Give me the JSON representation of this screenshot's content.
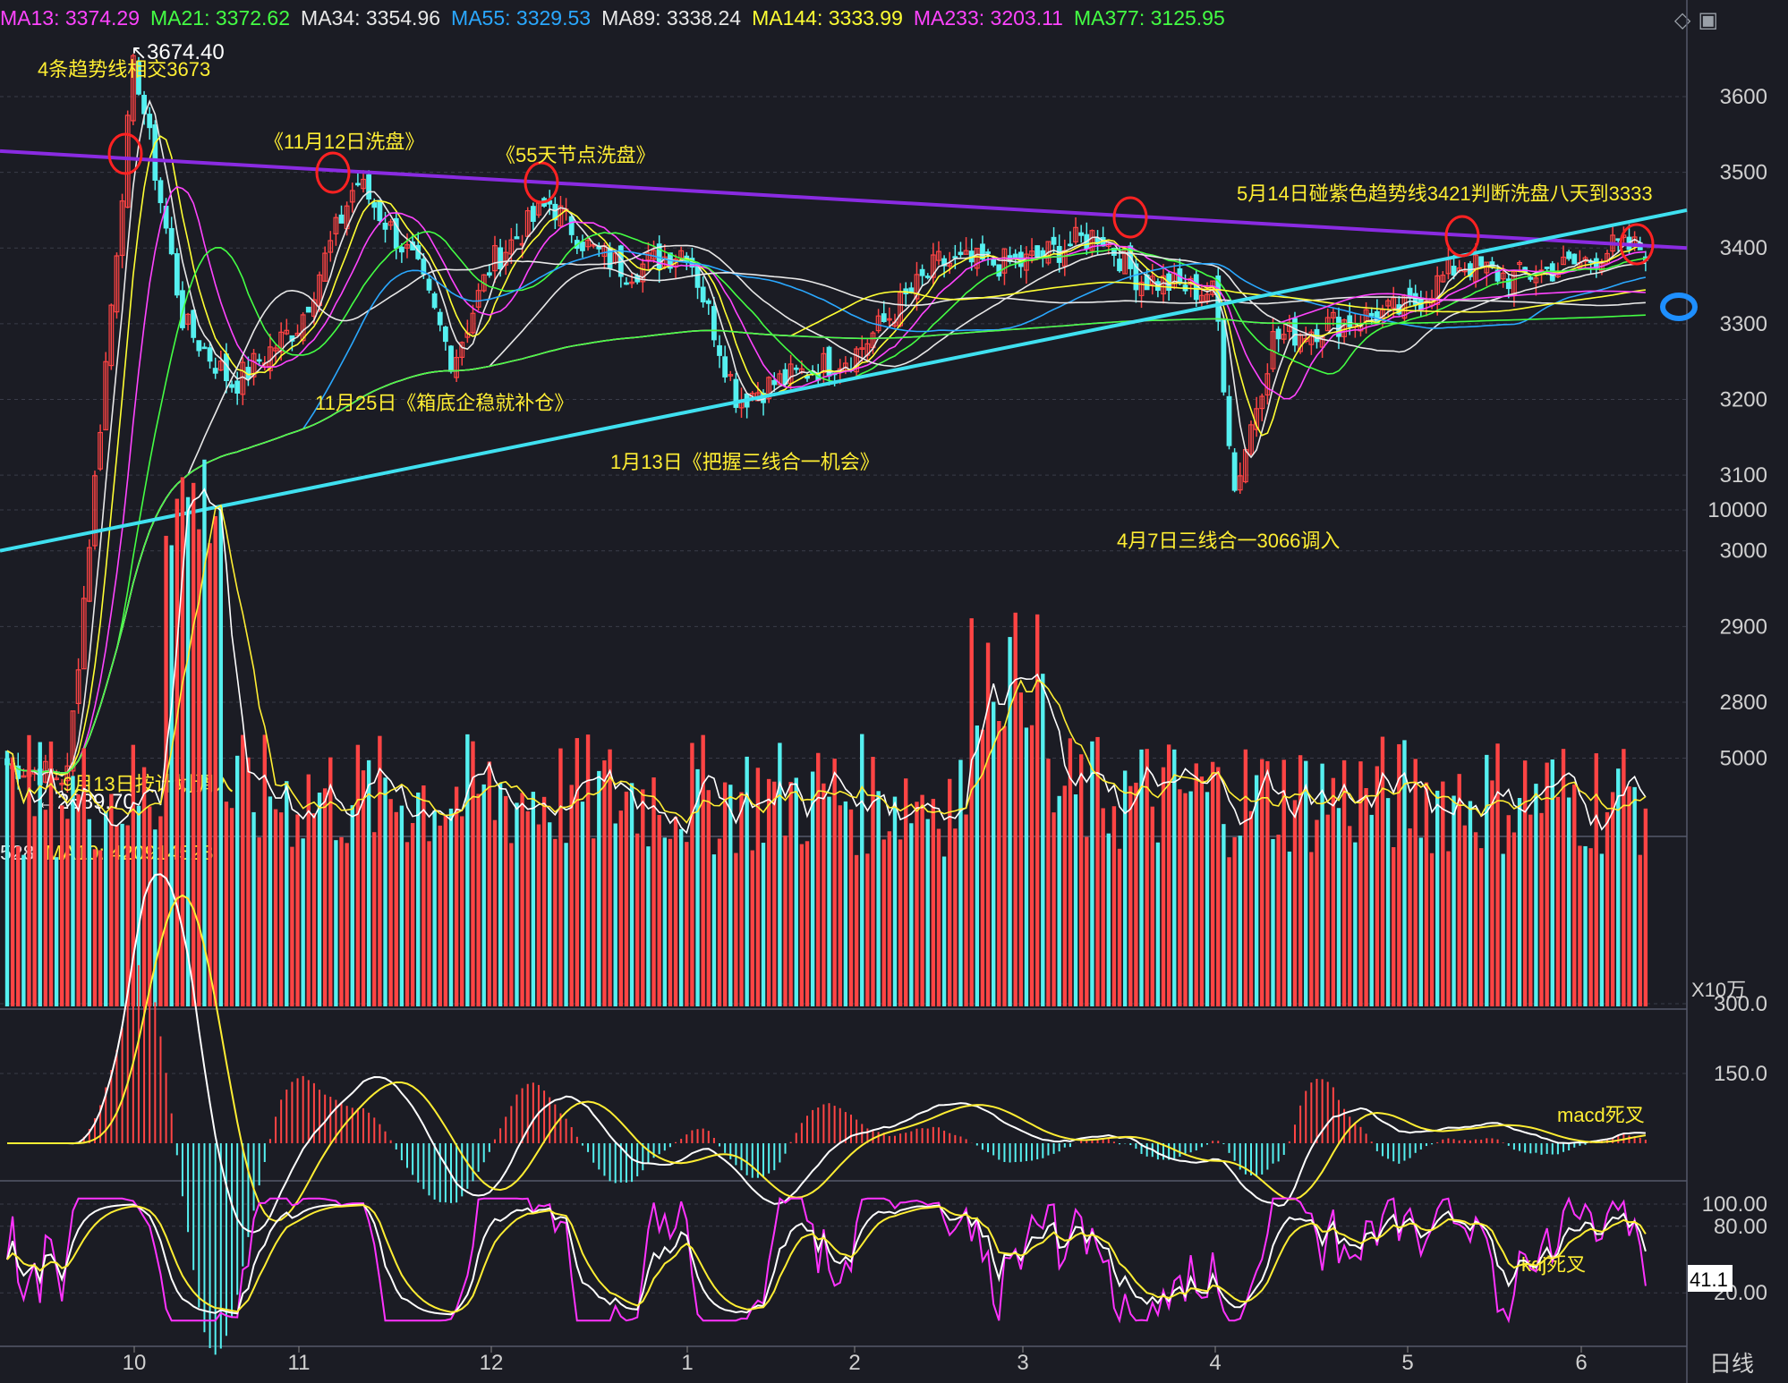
{
  "header": {
    "ma": [
      {
        "label": "MA13: 3374.29",
        "color": "#ff44ff"
      },
      {
        "label": "MA21: 3372.62",
        "color": "#44ff44"
      },
      {
        "label": "MA34: 3354.96",
        "color": "#e8e8e8"
      },
      {
        "label": "MA55: 3329.53",
        "color": "#2aa8ff"
      },
      {
        "label": "MA89: 3338.24",
        "color": "#e8e8e8"
      },
      {
        "label": "MA144: 3333.99",
        "color": "#ffff33"
      },
      {
        "label": "MA233: 3203.11",
        "color": "#ff44ff"
      },
      {
        "label": "MA377: 3125.95",
        "color": "#44ff44"
      }
    ],
    "icons": [
      "diamond-icon",
      "panel-icon"
    ]
  },
  "volume_header": {
    "v1": "528",
    "v2": "MA10: 420914528"
  },
  "colors": {
    "up": "#ff4444",
    "down": "#55f0f0",
    "trend_purple": "#8a2be2",
    "trend_cyan": "#3fe0f0",
    "annot": "#ffee33",
    "circle": "#ff2222",
    "grid": "#3a3c48",
    "axis_text": "#d0d0d0",
    "mark": "#1e8fff"
  },
  "chart_data": {
    "type": "candlestick",
    "x_months": [
      "10",
      "11",
      "12",
      "1",
      "2",
      "3",
      "4",
      "5",
      "6"
    ],
    "period_label": "日线",
    "price_axis": {
      "ticks": [
        2800,
        2900,
        3000,
        3100,
        3200,
        3300,
        3400,
        3500,
        3600
      ]
    },
    "volume_axis": {
      "ticks": [
        5000,
        10000
      ],
      "unit": "X10万"
    },
    "macd_axis": {
      "ticks": [
        150.0,
        300.0
      ]
    },
    "kdj_axis": {
      "ticks": [
        20.0,
        80.0,
        100.0
      ],
      "current": "41.1"
    },
    "high_label": "3674.40",
    "low_label": "←2689.70",
    "price_path": [
      [
        "9",
        2720
      ],
      [
        "9.5",
        2700
      ],
      [
        "10",
        3650
      ],
      [
        "10.3",
        3300
      ],
      [
        "10.6",
        3220
      ],
      [
        "11",
        3300
      ],
      [
        "11.3",
        3490
      ],
      [
        "11.6",
        3380
      ],
      [
        "11.8",
        3250
      ],
      [
        "12",
        3380
      ],
      [
        "12.3",
        3460
      ],
      [
        "12.5",
        3400
      ],
      [
        "12.7",
        3370
      ],
      [
        "1",
        3400
      ],
      [
        "1.3",
        3200
      ],
      [
        "1.5",
        3220
      ],
      [
        "2",
        3260
      ],
      [
        "2.5",
        3380
      ],
      [
        "3",
        3380
      ],
      [
        "3.4",
        3420
      ],
      [
        "3.6",
        3360
      ],
      [
        "4",
        3340
      ],
      [
        "4.1",
        3080
      ],
      [
        "4.3",
        3280
      ],
      [
        "4.6",
        3300
      ],
      [
        "5",
        3320
      ],
      [
        "5.3",
        3380
      ],
      [
        "5.6",
        3360
      ],
      [
        "6",
        3380
      ],
      [
        "6.4",
        3400
      ]
    ],
    "trendlines": [
      {
        "name": "purple",
        "from": [
          "9",
          3528
        ],
        "to": [
          "6.5",
          3400
        ]
      },
      {
        "name": "cyan",
        "from": [
          "9",
          3000
        ],
        "to": [
          "6.5",
          3450
        ]
      }
    ],
    "annotations": [
      {
        "text": "4条趋势线相交3673"
      },
      {
        "text": "《11月12日洗盘》"
      },
      {
        "text": "《55天节点洗盘》"
      },
      {
        "text": "5月14日碰紫色趋势线3421判断洗盘八天到3333"
      },
      {
        "text": "11月25日《箱底企稳就补仓》"
      },
      {
        "text": "1月13日《把握三线合一机会》"
      },
      {
        "text": "4月7日三线合一3066调入"
      },
      {
        "text": "9月13日按计划调入"
      },
      {
        "text": "macd死叉"
      },
      {
        "text": "kdj死叉"
      }
    ]
  }
}
